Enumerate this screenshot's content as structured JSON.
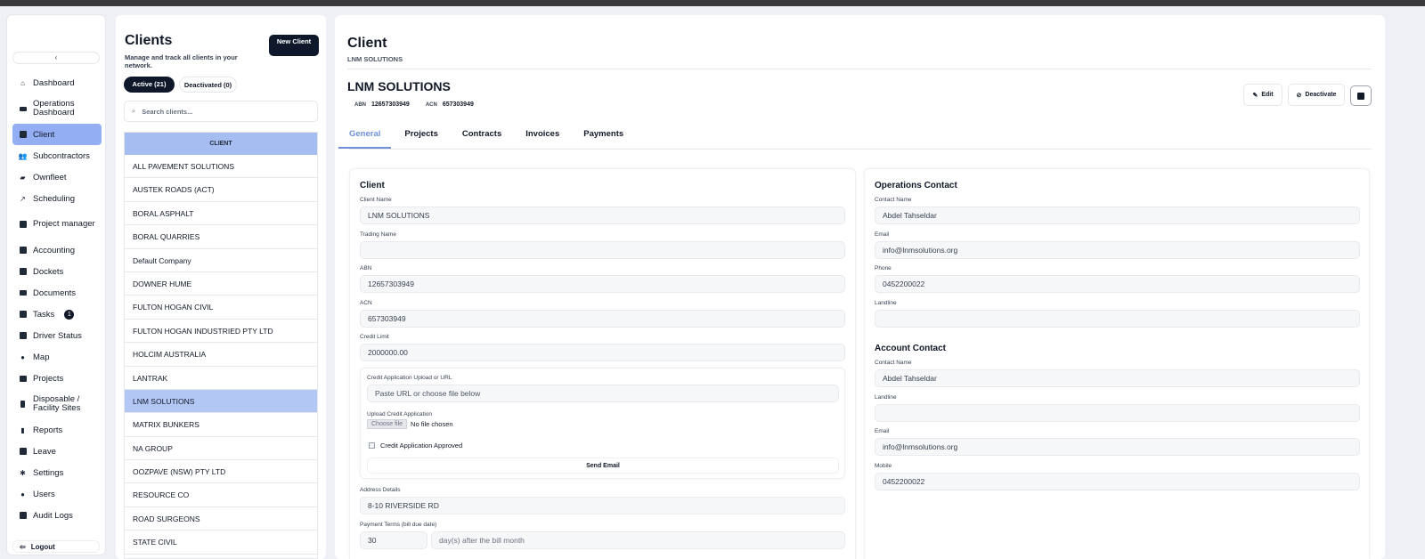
{
  "sidebar": {
    "collapse_label": "‹",
    "items": [
      {
        "label": "Dashboard",
        "icon": "home-icon"
      },
      {
        "label": "Operations Dashboard",
        "icon": "dashboard-icon"
      },
      {
        "label": "Client",
        "icon": "client-icon"
      },
      {
        "label": "Subcontractors",
        "icon": "users-icon"
      },
      {
        "label": "Ownfleet",
        "icon": "truck-icon"
      },
      {
        "label": "Scheduling",
        "icon": "chart-line-icon"
      },
      {
        "label": "Project manager",
        "icon": "project-icon"
      },
      {
        "label": "Accounting",
        "icon": "accounting-icon"
      },
      {
        "label": "Dockets",
        "icon": "docket-icon"
      },
      {
        "label": "Documents",
        "icon": "folder-icon"
      },
      {
        "label": "Tasks",
        "icon": "task-icon",
        "badge": "1"
      },
      {
        "label": "Driver Status",
        "icon": "driver-icon"
      },
      {
        "label": "Map",
        "icon": "map-pin-icon"
      },
      {
        "label": "Projects",
        "icon": "briefcase-icon"
      },
      {
        "label": "Disposable / Facility Sites",
        "icon": "site-icon"
      },
      {
        "label": "Reports",
        "icon": "bar-chart-icon"
      },
      {
        "label": "Leave",
        "icon": "leave-icon"
      },
      {
        "label": "Settings",
        "icon": "gear-icon"
      },
      {
        "label": "Users",
        "icon": "user-icon"
      },
      {
        "label": "Audit Logs",
        "icon": "log-icon"
      }
    ],
    "logout_label": "Logout"
  },
  "clients_panel": {
    "title": "Clients",
    "subtitle": "Manage and track all clients in your network.",
    "new_button": "New Client",
    "tab_active": "Active (21)",
    "tab_deactivated": "Deactivated (0)",
    "search_placeholder": "Search clients...",
    "column_header": "CLIENT",
    "rows": [
      "ALL PAVEMENT SOLUTIONS",
      "AUSTEK ROADS (ACT)",
      "BORAL ASPHALT",
      "BORAL QUARRIES",
      "Default Company",
      "DOWNER HUME",
      "FULTON HOGAN CIVIL",
      "FULTON HOGAN INDUSTRIED PTY LTD",
      "HOLCIM AUSTRALIA",
      "LANTRAK",
      "LNM SOLUTIONS",
      "MATRIX BUNKERS",
      "NA GROUP",
      "OOZPAVE (NSW) PTY LTD",
      "RESOURCE CO",
      "ROAD SURGEONS",
      "STATE CIVIL"
    ],
    "selected_row": "LNM SOLUTIONS"
  },
  "main": {
    "title": "Client",
    "breadcrumb": "LNM SOLUTIONS",
    "company": "LNM SOLUTIONS",
    "abn_label": "ABN",
    "abn_value": "12657303949",
    "acn_label": "ACN",
    "acn_value": "657303949",
    "edit_label": "Edit",
    "deactivate_label": "Deactivate",
    "tabs": [
      "General",
      "Projects",
      "Contracts",
      "Invoices",
      "Payments"
    ],
    "client_card": {
      "heading": "Client",
      "client_name_label": "Client Name",
      "client_name": "LNM SOLUTIONS",
      "trading_name_label": "Trading Name",
      "trading_name": "",
      "abn_label": "ABN",
      "abn": "12657303949",
      "acn_label": "ACN",
      "acn": "657303949",
      "credit_limit_label": "Credit Limit",
      "credit_limit": "2000000.00",
      "credit_app_label": "Credit Application Upload or URL",
      "credit_app_placeholder": "Paste URL or choose file below",
      "upload_label": "Upload Credit Application",
      "choose_file": "Choose file",
      "no_file": "No file chosen",
      "approved_label": "Credit Application Approved",
      "send_email": "Send Email",
      "address_label": "Address Details",
      "address": "8-10 RIVERSIDE RD",
      "payment_terms_label": "Payment Terms (bill due date)",
      "payment_terms": "30",
      "payment_suffix": "day(s) after the bill month"
    },
    "ops_card": {
      "heading": "Operations Contact",
      "contact_label": "Contact Name",
      "contact": "Abdel Tahseldar",
      "email_label": "Email",
      "email": "info@lnmsolutions.org",
      "phone_label": "Phone",
      "phone": "0452200022",
      "landline_label": "Landline",
      "landline": ""
    },
    "account_card": {
      "heading": "Account Contact",
      "contact_label": "Contact Name",
      "contact": "Abdel Tahseldar",
      "landline_label": "Landline",
      "landline": "",
      "email_label": "Email",
      "email": "info@lnmsolutions.org",
      "mobile_label": "Mobile",
      "mobile": "0452200022"
    }
  },
  "colors": {
    "accent": "#6f8fd9",
    "active_nav": "#93aef2",
    "primary_button": "#0f172a"
  }
}
